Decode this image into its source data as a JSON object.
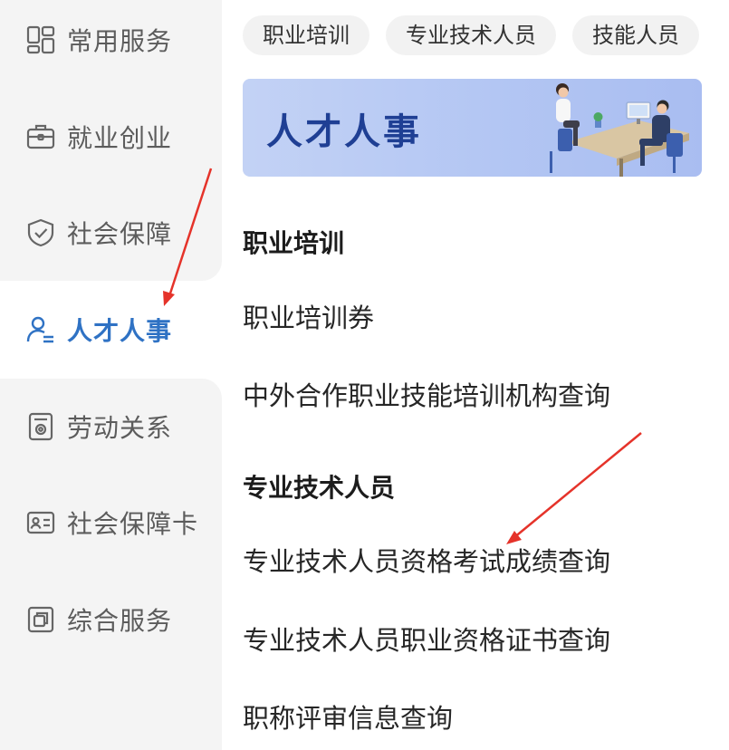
{
  "sidebar": {
    "items": [
      {
        "label": "常用服务",
        "icon": "grid-apps-icon"
      },
      {
        "label": "就业创业",
        "icon": "briefcase-icon"
      },
      {
        "label": "社会保障",
        "icon": "shield-check-icon"
      },
      {
        "label": "人才人事",
        "icon": "person-list-icon",
        "active": true
      },
      {
        "label": "劳动关系",
        "icon": "document-seal-icon"
      },
      {
        "label": "社会保障卡",
        "icon": "id-card-icon"
      },
      {
        "label": "综合服务",
        "icon": "copy-squares-icon"
      }
    ]
  },
  "tabs": [
    "职业培训",
    "专业技术人员",
    "技能人员"
  ],
  "banner": {
    "title": "人才人事"
  },
  "sections": [
    {
      "title": "职业培训",
      "items": [
        "职业培训券",
        "中外合作职业技能培训机构查询"
      ]
    },
    {
      "title": "专业技术人员",
      "items": [
        "专业技术人员资格考试成绩查询",
        "专业技术人员职业资格证书查询",
        "职称评审信息查询"
      ]
    }
  ],
  "colors": {
    "accent": "#2f72c4",
    "sidebar_bg": "#f4f4f4",
    "banner_title": "#1f3f94",
    "annotation_arrow": "#e5332a"
  }
}
